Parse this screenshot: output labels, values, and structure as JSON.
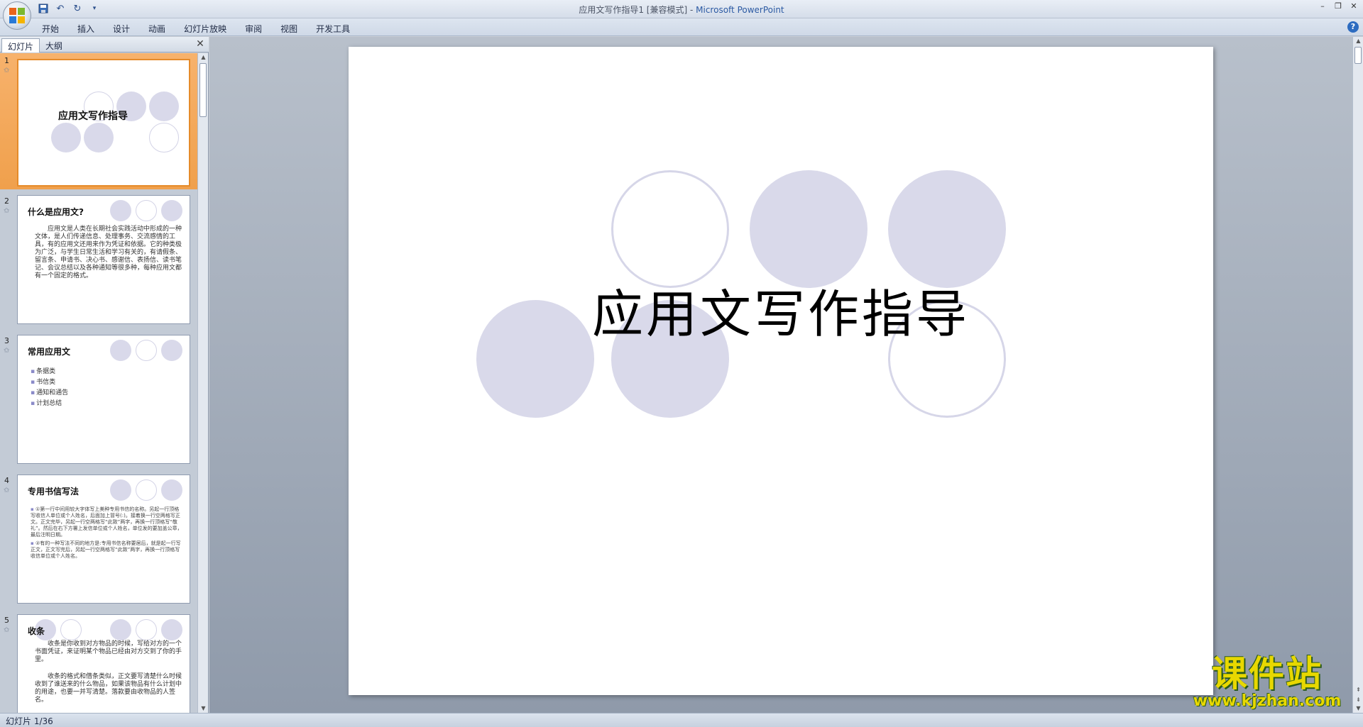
{
  "window": {
    "title_doc": "应用文写作指导1 [兼容模式] - ",
    "title_app": "Microsoft PowerPoint"
  },
  "ribbon": {
    "tabs": [
      "开始",
      "插入",
      "设计",
      "动画",
      "幻灯片放映",
      "审阅",
      "视图",
      "开发工具"
    ]
  },
  "panel": {
    "tab_slides": "幻灯片",
    "tab_outline": "大纲"
  },
  "thumbnails": [
    {
      "num": "1",
      "title": "应用文写作指导"
    },
    {
      "num": "2",
      "title": "什么是应用文?",
      "body": "应用文是人类在长期社会实践活动中形成的一种文体，是人们传递信息、处理事务、交流感情的工具，有的应用文还用来作为凭证和依据。它的种类极为广泛，与学生日常生活和学习有关的，有请假条、留言条、申请书、决心书、感谢信、表扬信、读书笔记、会议总结以及各种通知等很多种，每种应用文都有一个固定的格式。"
    },
    {
      "num": "3",
      "title": "常用应用文",
      "bullets": [
        "条据类",
        "书信类",
        "通知和通告",
        "计划总结"
      ]
    },
    {
      "num": "4",
      "title": "专用书信写法",
      "paras": [
        "①第一行中间用较大字体写上美种专用书信的名称。另起一行顶格写收信人单位或个人姓名，后面加上冒号(:)。接着换一行空两格写正文。正文完毕，另起一行空两格写“此致”两字，再换一行顶格写“敬礼”。然后在右下方署上发信单位或个人姓名，单位发的要加盖公章，最后注明日期。",
        "②有的一种写法不同的地方是:专用书信名称要居后，就是起一行写正文，正文写完后，另起一行空两格写“此致”两字，再换一行顶格写收信单位或个人姓名。"
      ]
    },
    {
      "num": "5",
      "title": "收条",
      "body": "收条是你收到对方物品的时候，写给对方的一个书面凭证，来证明某个物品已经由对方交到了你的手里。",
      "body2": "收条的格式和借条类似，正文要写清楚什么时候收到了谁送来的什么物品，如果该物品有什么计划中的用途，也要一并写清楚。落款要由收物品的人签名。"
    }
  ],
  "slide": {
    "title": "应用文写作指导"
  },
  "status": {
    "text": "幻灯片 1/36"
  },
  "watermark": {
    "cn": "课件站",
    "url": "www.kjzhan.com"
  },
  "colors": {
    "circle_fill": "#d9d9ea",
    "circle_outline": "#d6d6e8",
    "selected_thumb": "#f0a04c"
  }
}
